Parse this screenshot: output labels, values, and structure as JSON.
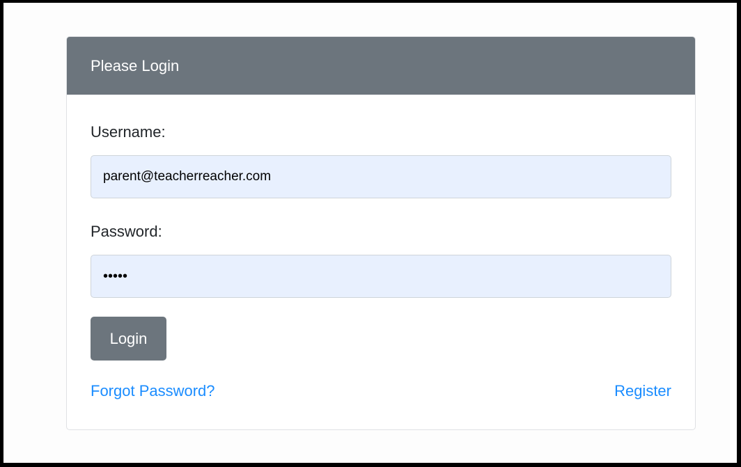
{
  "login": {
    "title": "Please Login",
    "username_label": "Username:",
    "username_value": "parent@teacherreacher.com",
    "password_label": "Password:",
    "password_value": "•••••",
    "submit_label": "Login",
    "forgot_link": "Forgot Password?",
    "register_link": "Register"
  },
  "colors": {
    "header_bg": "#6c757d",
    "input_bg": "#e8f0fe",
    "link": "#1a8cff"
  }
}
